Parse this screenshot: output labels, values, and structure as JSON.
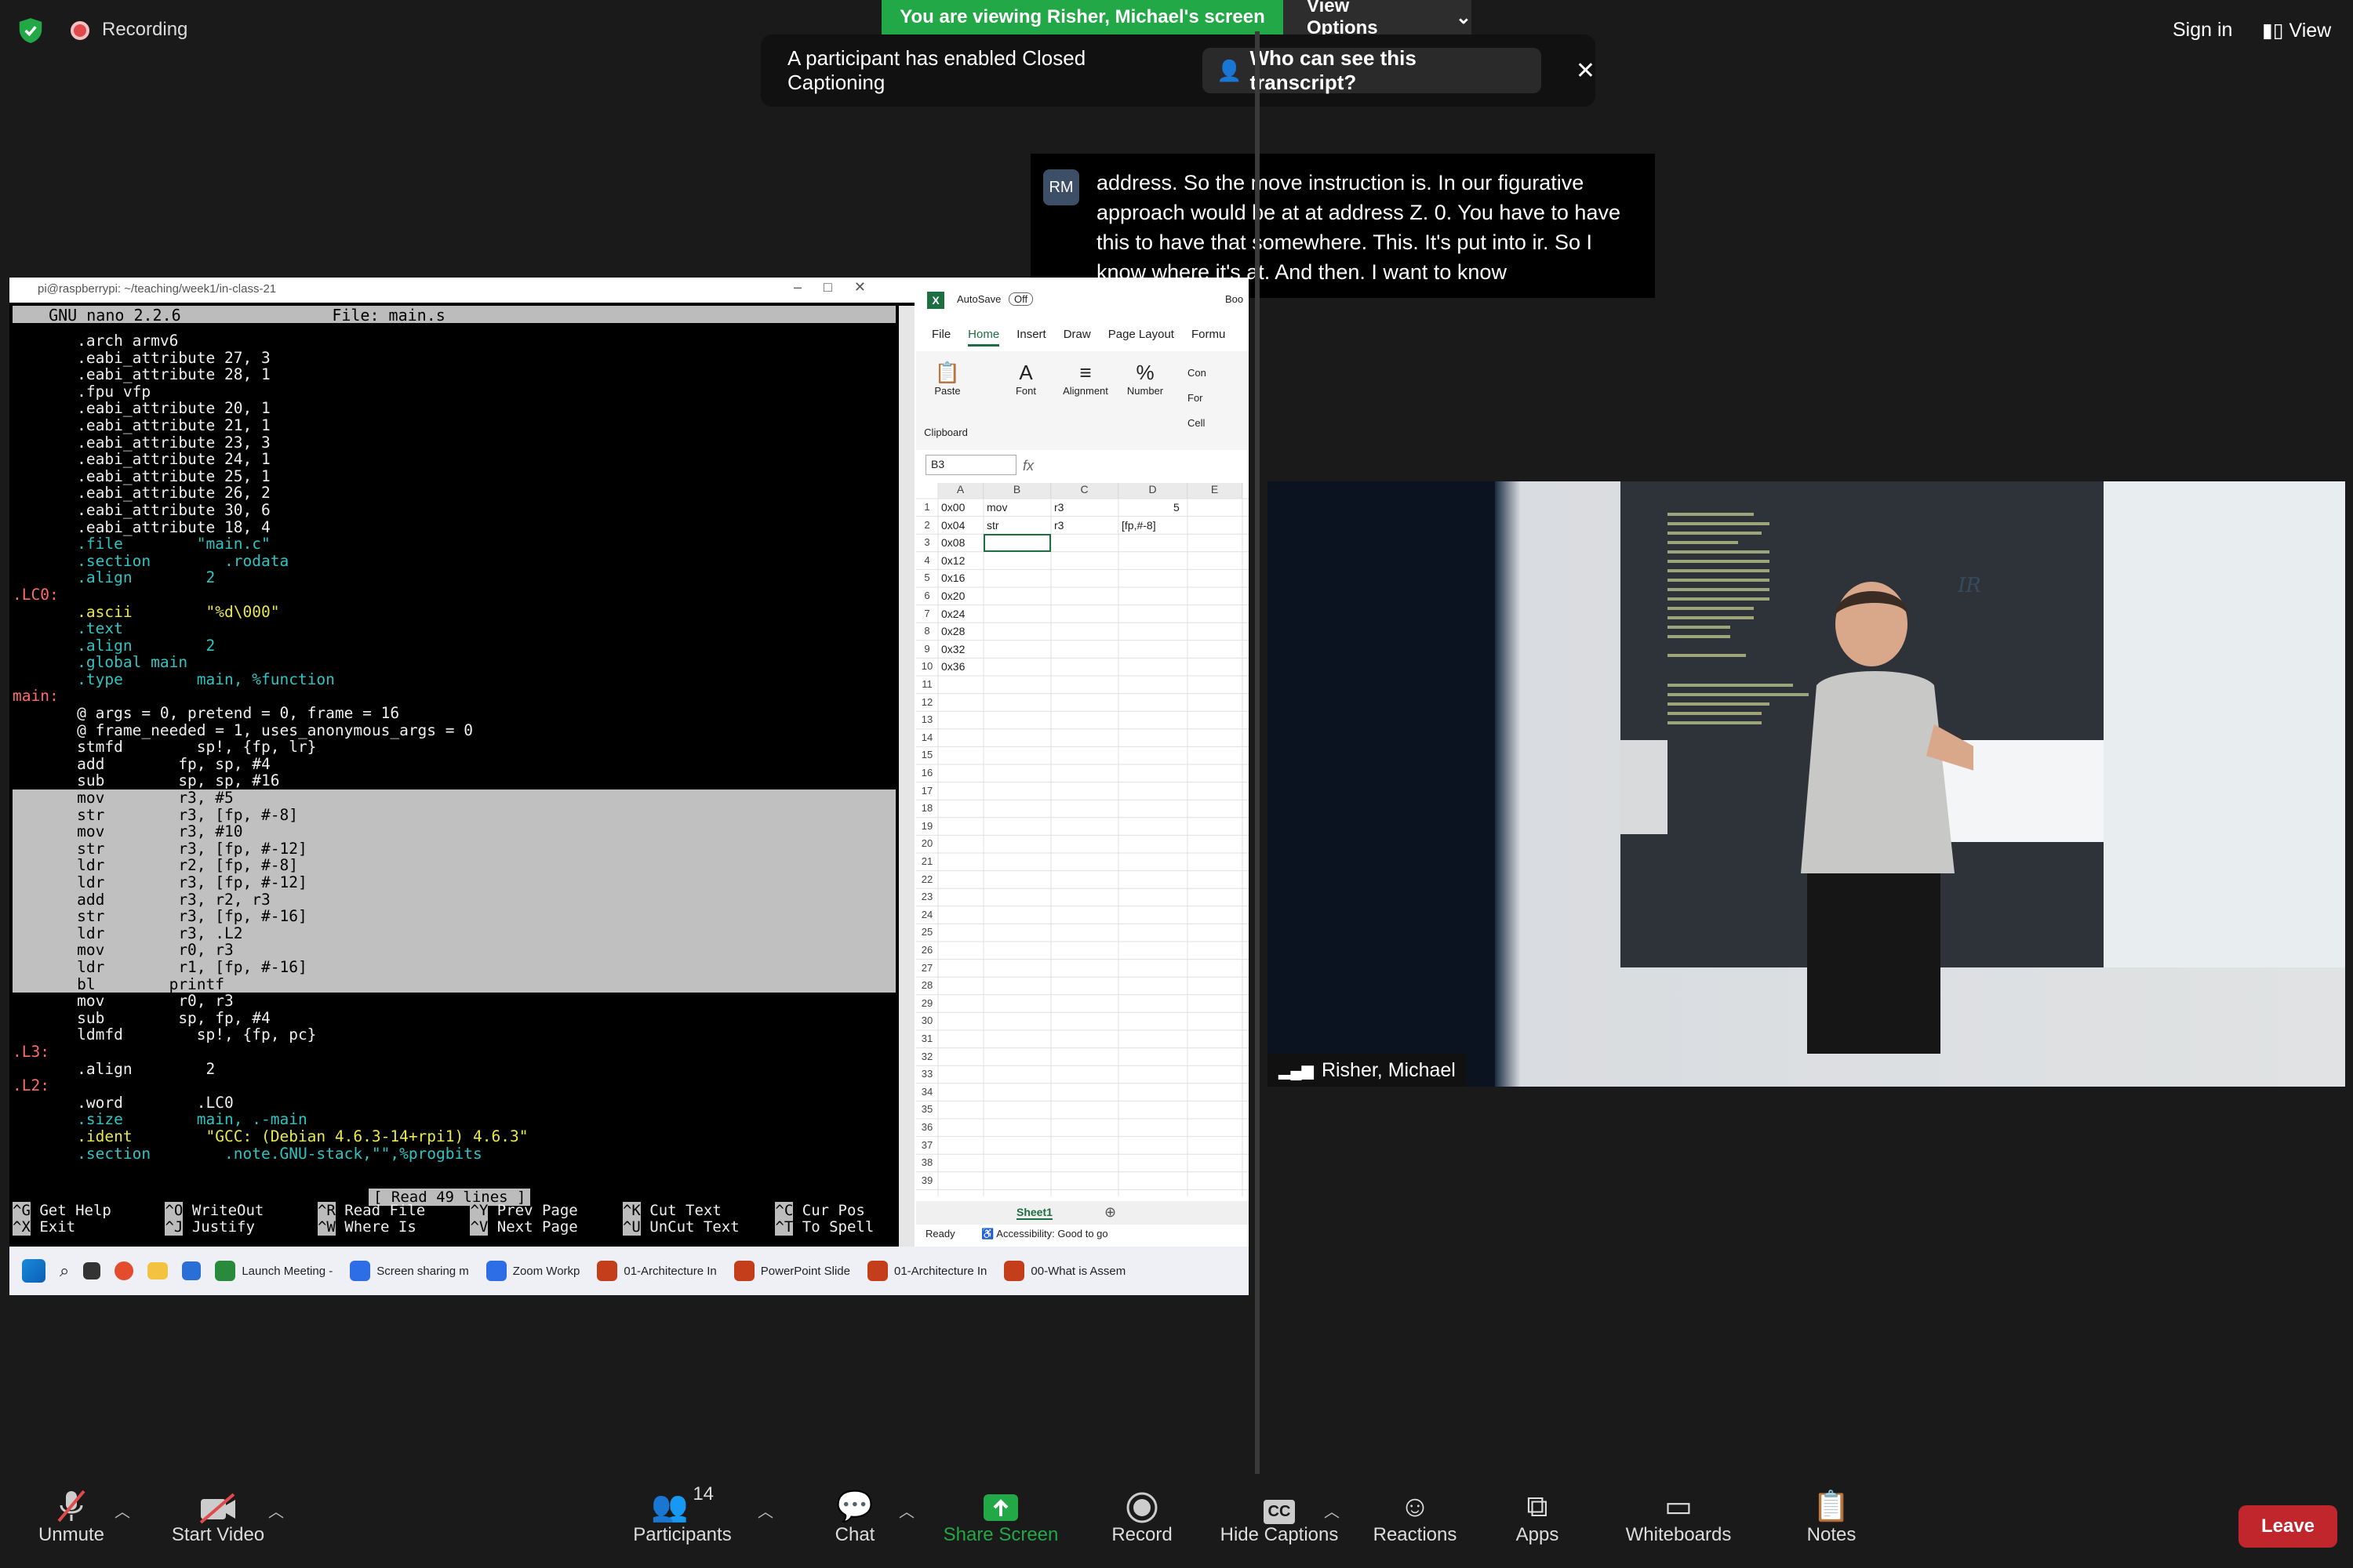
{
  "top": {
    "recording_label": "Recording",
    "viewing_label": "You are viewing Risher, Michael's screen",
    "view_options_label": "View Options",
    "sign_in_label": "Sign in",
    "view_label": "View"
  },
  "cc_banner": {
    "message": "A participant has enabled Closed Captioning",
    "who_label": "Who can see this transcript?"
  },
  "caption": {
    "initials": "RM",
    "text": "address. So the move instruction is. In our figurative approach would be at at address Z. 0. You have to have this to have that somewhere. This. It's put into ir. So I know where it's at. And then. I want to know"
  },
  "terminal": {
    "title": "pi@raspberrypi: ~/teaching/week1/in-class-21",
    "nano_header": "  GNU nano 2.2.6                File: main.s",
    "read_lines": "[ Read 49 lines ]",
    "shortcuts_row1": [
      [
        "^G",
        "Get Help"
      ],
      [
        "^O",
        "WriteOut"
      ],
      [
        "^R",
        "Read File"
      ],
      [
        "^Y",
        "Prev Page"
      ],
      [
        "^K",
        "Cut Text"
      ],
      [
        "^C",
        "Cur Pos"
      ]
    ],
    "shortcuts_row2": [
      [
        "^X",
        "Exit"
      ],
      [
        "^J",
        "Justify"
      ],
      [
        "^W",
        "Where Is"
      ],
      [
        "^V",
        "Next Page"
      ],
      [
        "^U",
        "UnCut Text"
      ],
      [
        "^T",
        "To Spell"
      ]
    ],
    "code": [
      [
        "",
        "\t.arch armv6"
      ],
      [
        "",
        "\t.eabi_attribute 27, 3"
      ],
      [
        "",
        "\t.eabi_attribute 28, 1"
      ],
      [
        "",
        "\t.fpu vfp"
      ],
      [
        "",
        "\t.eabi_attribute 20, 1"
      ],
      [
        "",
        "\t.eabi_attribute 21, 1"
      ],
      [
        "",
        "\t.eabi_attribute 23, 3"
      ],
      [
        "",
        "\t.eabi_attribute 24, 1"
      ],
      [
        "",
        "\t.eabi_attribute 25, 1"
      ],
      [
        "",
        "\t.eabi_attribute 26, 2"
      ],
      [
        "",
        "\t.eabi_attribute 30, 6"
      ],
      [
        "",
        "\t.eabi_attribute 18, 4"
      ],
      [
        "dir",
        "\t.file\t\"main.c\""
      ],
      [
        "dir",
        "\t.section\t.rodata"
      ],
      [
        "dir",
        "\t.align\t2"
      ],
      [
        "lbl",
        ".LC0:"
      ],
      [
        "str",
        "\t.ascii\t\"%d\\000\""
      ],
      [
        "dir",
        "\t.text"
      ],
      [
        "dir",
        "\t.align\t2"
      ],
      [
        "dir",
        "\t.global main"
      ],
      [
        "dir",
        "\t.type\tmain, %function"
      ],
      [
        "lbl",
        "main:"
      ],
      [
        "",
        "\t@ args = 0, pretend = 0, frame = 16"
      ],
      [
        "",
        "\t@ frame_needed = 1, uses_anonymous_args = 0"
      ],
      [
        "",
        "\tstmfd\tsp!, {fp, lr}"
      ],
      [
        "",
        "\tadd\tfp, sp, #4"
      ],
      [
        "",
        "\tsub\tsp, sp, #16"
      ],
      [
        "hl",
        "\tmov\tr3, #5"
      ],
      [
        "hl",
        "\tstr\tr3, [fp, #-8]"
      ],
      [
        "hl",
        "\tmov\tr3, #10"
      ],
      [
        "hl",
        "\tstr\tr3, [fp, #-12]"
      ],
      [
        "hl",
        "\tldr\tr2, [fp, #-8]"
      ],
      [
        "hl",
        "\tldr\tr3, [fp, #-12]"
      ],
      [
        "hl",
        "\tadd\tr3, r2, r3"
      ],
      [
        "hl",
        "\tstr\tr3, [fp, #-16]"
      ],
      [
        "hl",
        "\tldr\tr3, .L2"
      ],
      [
        "hl",
        "\tmov\tr0, r3"
      ],
      [
        "hl",
        "\tldr\tr1, [fp, #-16]"
      ],
      [
        "hl",
        "\tbl\tprintf"
      ],
      [
        "",
        "\tmov\tr0, r3"
      ],
      [
        "",
        "\tsub\tsp, fp, #4"
      ],
      [
        "",
        "\tldmfd\tsp!, {fp, pc}"
      ],
      [
        "lbl",
        ".L3:"
      ],
      [
        "",
        "\t.align\t2"
      ],
      [
        "lbl",
        ".L2:"
      ],
      [
        "",
        "\t.word\t.LC0"
      ],
      [
        "dir",
        "\t.size\tmain, .-main"
      ],
      [
        "str",
        "\t.ident\t\"GCC: (Debian 4.6.3-14+rpi1) 4.6.3\""
      ],
      [
        "dir",
        "\t.section\t.note.GNU-stack,\"\",%progbits"
      ]
    ]
  },
  "excel": {
    "autosave": "AutoSave",
    "autosave_state": "Off",
    "book": "Boo",
    "tabs": [
      "File",
      "Home",
      "Insert",
      "Draw",
      "Page Layout",
      "Formu"
    ],
    "active_tab": "Home",
    "ribbon": {
      "paste": "Paste",
      "clipboard": "Clipboard",
      "font": "Font",
      "alignment": "Alignment",
      "number": "Number",
      "cond": "Con",
      "format": "For",
      "cell": "Cell"
    },
    "name_box": "B3",
    "fx": "fx",
    "columns": [
      "A",
      "B",
      "C",
      "D",
      "E"
    ],
    "row_count": 39,
    "col_a": [
      "0x00",
      "0x04",
      "0x08",
      "0x12",
      "0x16",
      "0x20",
      "0x24",
      "0x28",
      "0x32",
      "0x36"
    ],
    "row1": {
      "b": "mov",
      "c": "r3",
      "d": "5"
    },
    "row2": {
      "b": "str",
      "c": "r3",
      "d": "[fp,#-8]"
    },
    "sheet": "Sheet1",
    "status_ready": "Ready",
    "status_access": "Accessibility: Good to go"
  },
  "taskbar": {
    "apps": [
      "Launch Meeting -",
      "Screen sharing m",
      "Zoom Workp",
      "01-Architecture In",
      "PowerPoint Slide",
      "01-Architecture In",
      "00-What is Assem"
    ]
  },
  "camera": {
    "participant_name": "Risher, Michael",
    "board_label": "IR"
  },
  "toolbar": {
    "unmute": "Unmute",
    "start_video": "Start Video",
    "participants": "Participants",
    "participant_count": "14",
    "chat": "Chat",
    "share_screen": "Share Screen",
    "record": "Record",
    "hide_captions": "Hide Captions",
    "reactions": "Reactions",
    "apps": "Apps",
    "whiteboards": "Whiteboards",
    "notes": "Notes",
    "leave": "Leave"
  },
  "colors": {
    "share_green": "#22a846",
    "leave_red": "#c0262c",
    "excel_green": "#1d6f42"
  }
}
